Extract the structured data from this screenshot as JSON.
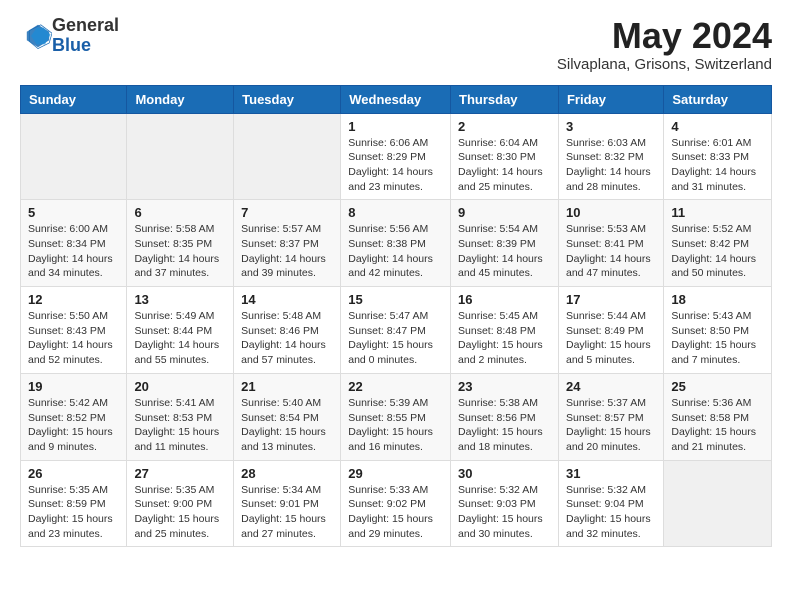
{
  "logo": {
    "general": "General",
    "blue": "Blue"
  },
  "header": {
    "month": "May 2024",
    "location": "Silvaplana, Grisons, Switzerland"
  },
  "weekdays": [
    "Sunday",
    "Monday",
    "Tuesday",
    "Wednesday",
    "Thursday",
    "Friday",
    "Saturday"
  ],
  "weeks": [
    [
      {
        "day": "",
        "info": ""
      },
      {
        "day": "",
        "info": ""
      },
      {
        "day": "",
        "info": ""
      },
      {
        "day": "1",
        "info": "Sunrise: 6:06 AM\nSunset: 8:29 PM\nDaylight: 14 hours\nand 23 minutes."
      },
      {
        "day": "2",
        "info": "Sunrise: 6:04 AM\nSunset: 8:30 PM\nDaylight: 14 hours\nand 25 minutes."
      },
      {
        "day": "3",
        "info": "Sunrise: 6:03 AM\nSunset: 8:32 PM\nDaylight: 14 hours\nand 28 minutes."
      },
      {
        "day": "4",
        "info": "Sunrise: 6:01 AM\nSunset: 8:33 PM\nDaylight: 14 hours\nand 31 minutes."
      }
    ],
    [
      {
        "day": "5",
        "info": "Sunrise: 6:00 AM\nSunset: 8:34 PM\nDaylight: 14 hours\nand 34 minutes."
      },
      {
        "day": "6",
        "info": "Sunrise: 5:58 AM\nSunset: 8:35 PM\nDaylight: 14 hours\nand 37 minutes."
      },
      {
        "day": "7",
        "info": "Sunrise: 5:57 AM\nSunset: 8:37 PM\nDaylight: 14 hours\nand 39 minutes."
      },
      {
        "day": "8",
        "info": "Sunrise: 5:56 AM\nSunset: 8:38 PM\nDaylight: 14 hours\nand 42 minutes."
      },
      {
        "day": "9",
        "info": "Sunrise: 5:54 AM\nSunset: 8:39 PM\nDaylight: 14 hours\nand 45 minutes."
      },
      {
        "day": "10",
        "info": "Sunrise: 5:53 AM\nSunset: 8:41 PM\nDaylight: 14 hours\nand 47 minutes."
      },
      {
        "day": "11",
        "info": "Sunrise: 5:52 AM\nSunset: 8:42 PM\nDaylight: 14 hours\nand 50 minutes."
      }
    ],
    [
      {
        "day": "12",
        "info": "Sunrise: 5:50 AM\nSunset: 8:43 PM\nDaylight: 14 hours\nand 52 minutes."
      },
      {
        "day": "13",
        "info": "Sunrise: 5:49 AM\nSunset: 8:44 PM\nDaylight: 14 hours\nand 55 minutes."
      },
      {
        "day": "14",
        "info": "Sunrise: 5:48 AM\nSunset: 8:46 PM\nDaylight: 14 hours\nand 57 minutes."
      },
      {
        "day": "15",
        "info": "Sunrise: 5:47 AM\nSunset: 8:47 PM\nDaylight: 15 hours\nand 0 minutes."
      },
      {
        "day": "16",
        "info": "Sunrise: 5:45 AM\nSunset: 8:48 PM\nDaylight: 15 hours\nand 2 minutes."
      },
      {
        "day": "17",
        "info": "Sunrise: 5:44 AM\nSunset: 8:49 PM\nDaylight: 15 hours\nand 5 minutes."
      },
      {
        "day": "18",
        "info": "Sunrise: 5:43 AM\nSunset: 8:50 PM\nDaylight: 15 hours\nand 7 minutes."
      }
    ],
    [
      {
        "day": "19",
        "info": "Sunrise: 5:42 AM\nSunset: 8:52 PM\nDaylight: 15 hours\nand 9 minutes."
      },
      {
        "day": "20",
        "info": "Sunrise: 5:41 AM\nSunset: 8:53 PM\nDaylight: 15 hours\nand 11 minutes."
      },
      {
        "day": "21",
        "info": "Sunrise: 5:40 AM\nSunset: 8:54 PM\nDaylight: 15 hours\nand 13 minutes."
      },
      {
        "day": "22",
        "info": "Sunrise: 5:39 AM\nSunset: 8:55 PM\nDaylight: 15 hours\nand 16 minutes."
      },
      {
        "day": "23",
        "info": "Sunrise: 5:38 AM\nSunset: 8:56 PM\nDaylight: 15 hours\nand 18 minutes."
      },
      {
        "day": "24",
        "info": "Sunrise: 5:37 AM\nSunset: 8:57 PM\nDaylight: 15 hours\nand 20 minutes."
      },
      {
        "day": "25",
        "info": "Sunrise: 5:36 AM\nSunset: 8:58 PM\nDaylight: 15 hours\nand 21 minutes."
      }
    ],
    [
      {
        "day": "26",
        "info": "Sunrise: 5:35 AM\nSunset: 8:59 PM\nDaylight: 15 hours\nand 23 minutes."
      },
      {
        "day": "27",
        "info": "Sunrise: 5:35 AM\nSunset: 9:00 PM\nDaylight: 15 hours\nand 25 minutes."
      },
      {
        "day": "28",
        "info": "Sunrise: 5:34 AM\nSunset: 9:01 PM\nDaylight: 15 hours\nand 27 minutes."
      },
      {
        "day": "29",
        "info": "Sunrise: 5:33 AM\nSunset: 9:02 PM\nDaylight: 15 hours\nand 29 minutes."
      },
      {
        "day": "30",
        "info": "Sunrise: 5:32 AM\nSunset: 9:03 PM\nDaylight: 15 hours\nand 30 minutes."
      },
      {
        "day": "31",
        "info": "Sunrise: 5:32 AM\nSunset: 9:04 PM\nDaylight: 15 hours\nand 32 minutes."
      },
      {
        "day": "",
        "info": ""
      }
    ]
  ]
}
